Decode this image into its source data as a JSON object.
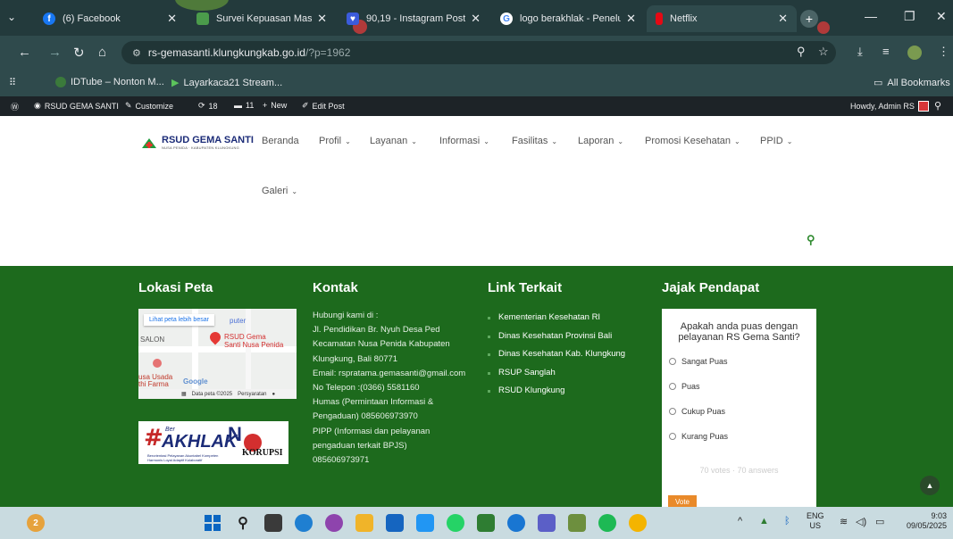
{
  "browser": {
    "tabs": [
      {
        "title": "(6) Facebook",
        "favicon": "f",
        "favicon_color": "#1877f2"
      },
      {
        "title": "Survei Kepuasan Masyarakat",
        "favicon": "",
        "favicon_color": "#4b9b4b"
      },
      {
        "title": "90,19 - Instagram Post -",
        "favicon": "♥",
        "favicon_color": "#3b5bdb"
      },
      {
        "title": "logo berakhlak - Penelusuran",
        "favicon": "G",
        "favicon_color": "#ffffff"
      },
      {
        "title": "Netflix",
        "favicon": "",
        "favicon_color": "#e50914"
      }
    ],
    "url_host": "rs-gemasanti.klungkungkab.go.id",
    "url_path": "/?p=1962",
    "bookmarks": [
      "IDTube – Nonton M...",
      "Layarkaca21 Stream..."
    ],
    "all_bookmarks": "All Bookmarks"
  },
  "wpbar": {
    "site": "RSUD GEMA SANTI",
    "customize": "Customize",
    "updates": "18",
    "comments": "11",
    "new": "New",
    "edit": "Edit Post",
    "howdy": "Howdy, Admin RS"
  },
  "site": {
    "logo_text": "RSUD GEMA SANTI",
    "logo_sub": "NUSA PENIDA · KABUPATEN KLUNGKUNG",
    "menu": [
      {
        "label": "Beranda",
        "has_sub": false
      },
      {
        "label": "Profil",
        "has_sub": true
      },
      {
        "label": "Layanan",
        "has_sub": true
      },
      {
        "label": "Informasi",
        "has_sub": true
      },
      {
        "label": "Fasilitas",
        "has_sub": true
      },
      {
        "label": "Laporan",
        "has_sub": true
      },
      {
        "label": "Promosi Kesehatan",
        "has_sub": true
      },
      {
        "label": "PPID",
        "has_sub": true
      },
      {
        "label": "Galeri",
        "has_sub": true
      }
    ],
    "chevron": "⌄"
  },
  "footer": {
    "lokasi": {
      "title": "Lokasi Peta",
      "map_link": "Lihat peta lebih besar",
      "map_labels": [
        "puter",
        "SALON",
        "RSUD Gema",
        "Santi Nusa Penida",
        "usa Usada",
        "thi Farma",
        "Google"
      ],
      "map_footer": [
        "Data peta ©2025",
        "Persyaratan"
      ],
      "akhlak_text": "AKHLAK",
      "akhlak_prefix": "Ber",
      "korupsi_text": "KORUPSI",
      "akhlak_caption": "Berorientasi Pelayanan Akuntabel Kompeten Harmonis Loyal Adaptif Kolaboratif"
    },
    "kontak": {
      "title": "Kontak",
      "lines": [
        "Hubungi kami di :",
        "Jl. Pendidikan Br. Nyuh Desa Ped",
        "Kecamatan Nusa Penida Kabupaten",
        "Klungkung, Bali 80771",
        "Email: rspratama.gemasanti@gmail.com",
        "No Telepon :(0366) 5581160",
        "Humas (Permintaan Informasi &",
        "Pengaduan) 085606973970",
        "PIPP (Informasi dan pelayanan",
        "pengaduan terkait BPJS)",
        "085606973971"
      ]
    },
    "links": {
      "title": "Link Terkait",
      "items": [
        "Kementerian Kesehatan RI",
        "Dinas Kesehatan Provinsi Bali",
        "Dinas Kesehatan Kab. Klungkung",
        "RSUP Sanglah",
        "RSUD Klungkung"
      ]
    },
    "poll": {
      "title": "Jajak Pendapat",
      "question": "Apakah anda puas dengan pelayanan RS Gema Santi?",
      "options": [
        "Sangat Puas",
        "Puas",
        "Cukup Puas",
        "Kurang Puas"
      ],
      "votes": "70 votes · 70 answers",
      "vote_button": "Vote"
    }
  },
  "taskbar": {
    "notification_count": "2",
    "lang": "ENG",
    "region": "US",
    "time": "9:03",
    "date": "09/05/2025"
  }
}
